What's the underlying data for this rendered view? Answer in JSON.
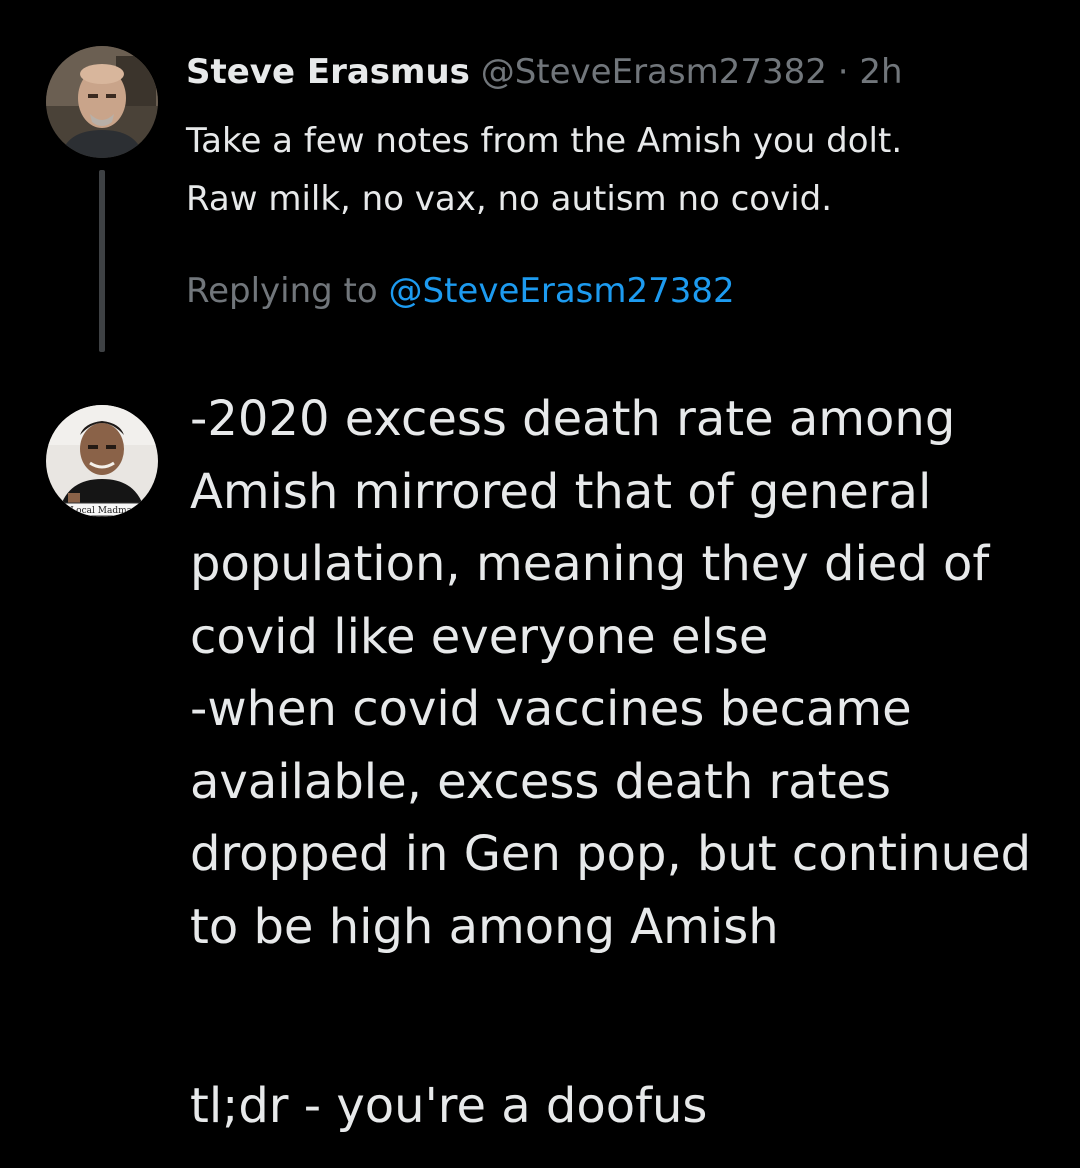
{
  "original_tweet": {
    "display_name": "Steve Erasmus",
    "handle": "@SteveErasm27382",
    "separator": "·",
    "time": "2h",
    "text_line1": "Take a few notes from the Amish you dolt.",
    "text_line2": "Raw milk, no vax, no autism no covid.",
    "replying_prefix": "Replying to",
    "replying_handle": "@SteveErasm27382"
  },
  "reply": {
    "text": "-2020 excess death rate among Amish mirrored that of general population, meaning they died of covid like everyone else\n-when covid vaccines became available, excess death rates dropped in Gen pop, but continued to be high among Amish",
    "tldr": "tl;dr - you're a doofus",
    "avatar_sign": "Local Madman"
  },
  "colors": {
    "background": "#000000",
    "primary_text": "#e7e9ea",
    "secondary_text": "#71767b",
    "link": "#1d9bf0",
    "thread_line": "#3e4144"
  },
  "icons": {
    "avatar1": "user-avatar-photo",
    "avatar2": "user-avatar-photo"
  }
}
